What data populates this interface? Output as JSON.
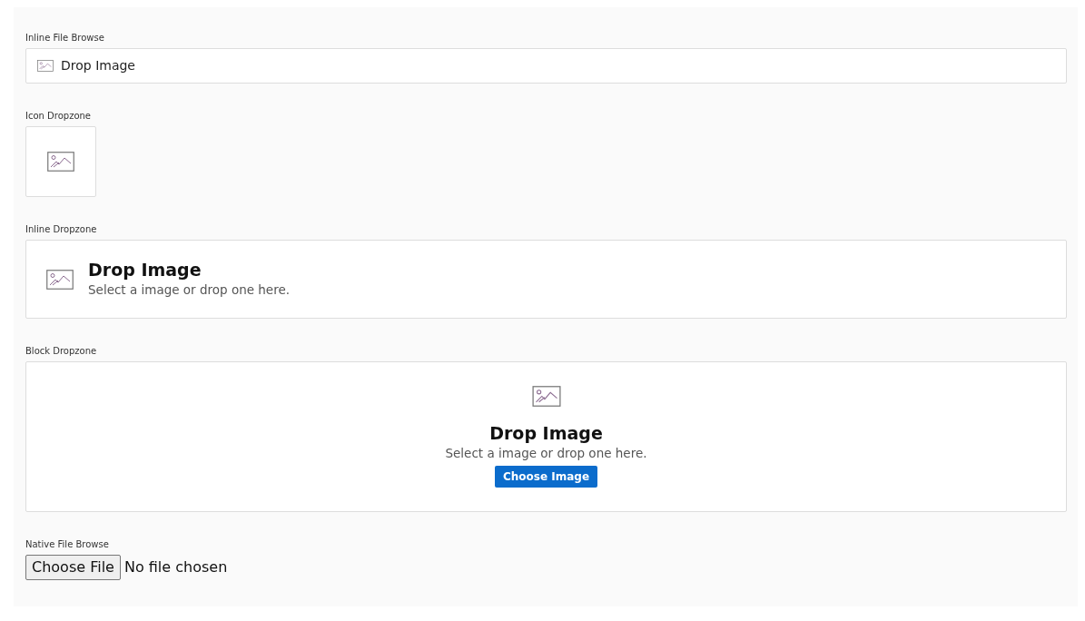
{
  "sections": [
    {
      "kind": "inline_browse",
      "label": "Inline File Browse",
      "title": "Drop Image"
    },
    {
      "kind": "icon",
      "label": "Icon Dropzone"
    },
    {
      "kind": "inline",
      "label": "Inline Dropzone",
      "title": "Drop Image",
      "hint": "Select a image or drop one here."
    },
    {
      "kind": "block",
      "label": "Block Dropzone",
      "title": "Drop Image",
      "hint": "Select a image or drop one here.",
      "button": "Choose Image"
    },
    {
      "kind": "native",
      "label": "Native File Browse",
      "button": "Choose File",
      "status": "No file chosen"
    }
  ]
}
